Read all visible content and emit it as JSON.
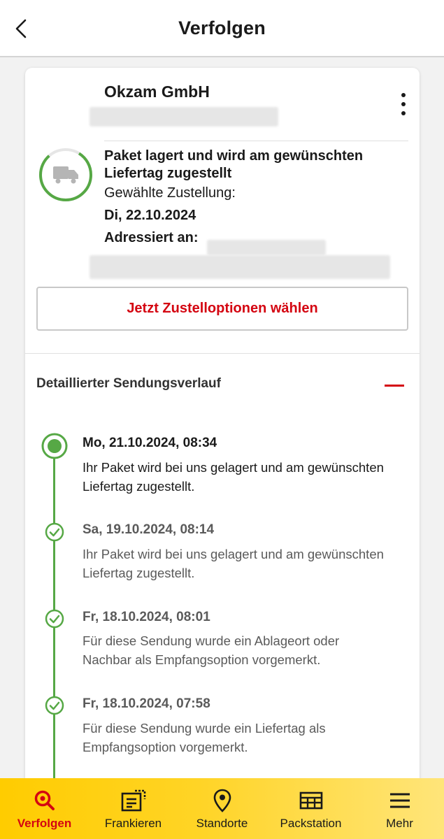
{
  "header": {
    "title": "Verfolgen",
    "back_icon": "chevron-left-icon"
  },
  "shipment": {
    "sender": "Okzam GmbH",
    "status_title": "Paket lagert und wird am gewünschten Liefertag zugestellt",
    "delivery_label": "Gewählte Zustellung:",
    "delivery_date": "Di, 22.10.2024",
    "address_label": "Adressiert an:",
    "options_button": "Jetzt Zustelloptionen wählen",
    "status_icon": "truck-icon"
  },
  "history": {
    "title": "Detaillierter Sendungsverlauf",
    "events": [
      {
        "date": "Mo, 21.10.2024, 08:34",
        "text": "Ihr Paket wird bei uns gelagert und am gewünschten Liefertag zugestellt."
      },
      {
        "date": "Sa, 19.10.2024, 08:14",
        "text": "Ihr Paket wird bei uns gelagert und am gewünschten Liefertag zugestellt."
      },
      {
        "date": "Fr, 18.10.2024, 08:01",
        "text": "Für diese Sendung wurde ein Ablageort oder Nachbar als Empfangsoption vorgemerkt."
      },
      {
        "date": "Fr, 18.10.2024, 07:58",
        "text": "Für diese Sendung wurde ein Liefertag als Empfangsoption vorgemerkt."
      }
    ]
  },
  "nav": {
    "items": [
      {
        "label": "Verfolgen",
        "icon": "search-icon",
        "active": true
      },
      {
        "label": "Frankieren",
        "icon": "stamp-icon",
        "active": false
      },
      {
        "label": "Standorte",
        "icon": "location-pin-icon",
        "active": false
      },
      {
        "label": "Packstation",
        "icon": "packstation-icon",
        "active": false
      },
      {
        "label": "Mehr",
        "icon": "menu-icon",
        "active": false
      }
    ]
  },
  "colors": {
    "brand_yellow": "#ffcc00",
    "brand_red": "#d40511",
    "progress_green": "#56a845"
  }
}
